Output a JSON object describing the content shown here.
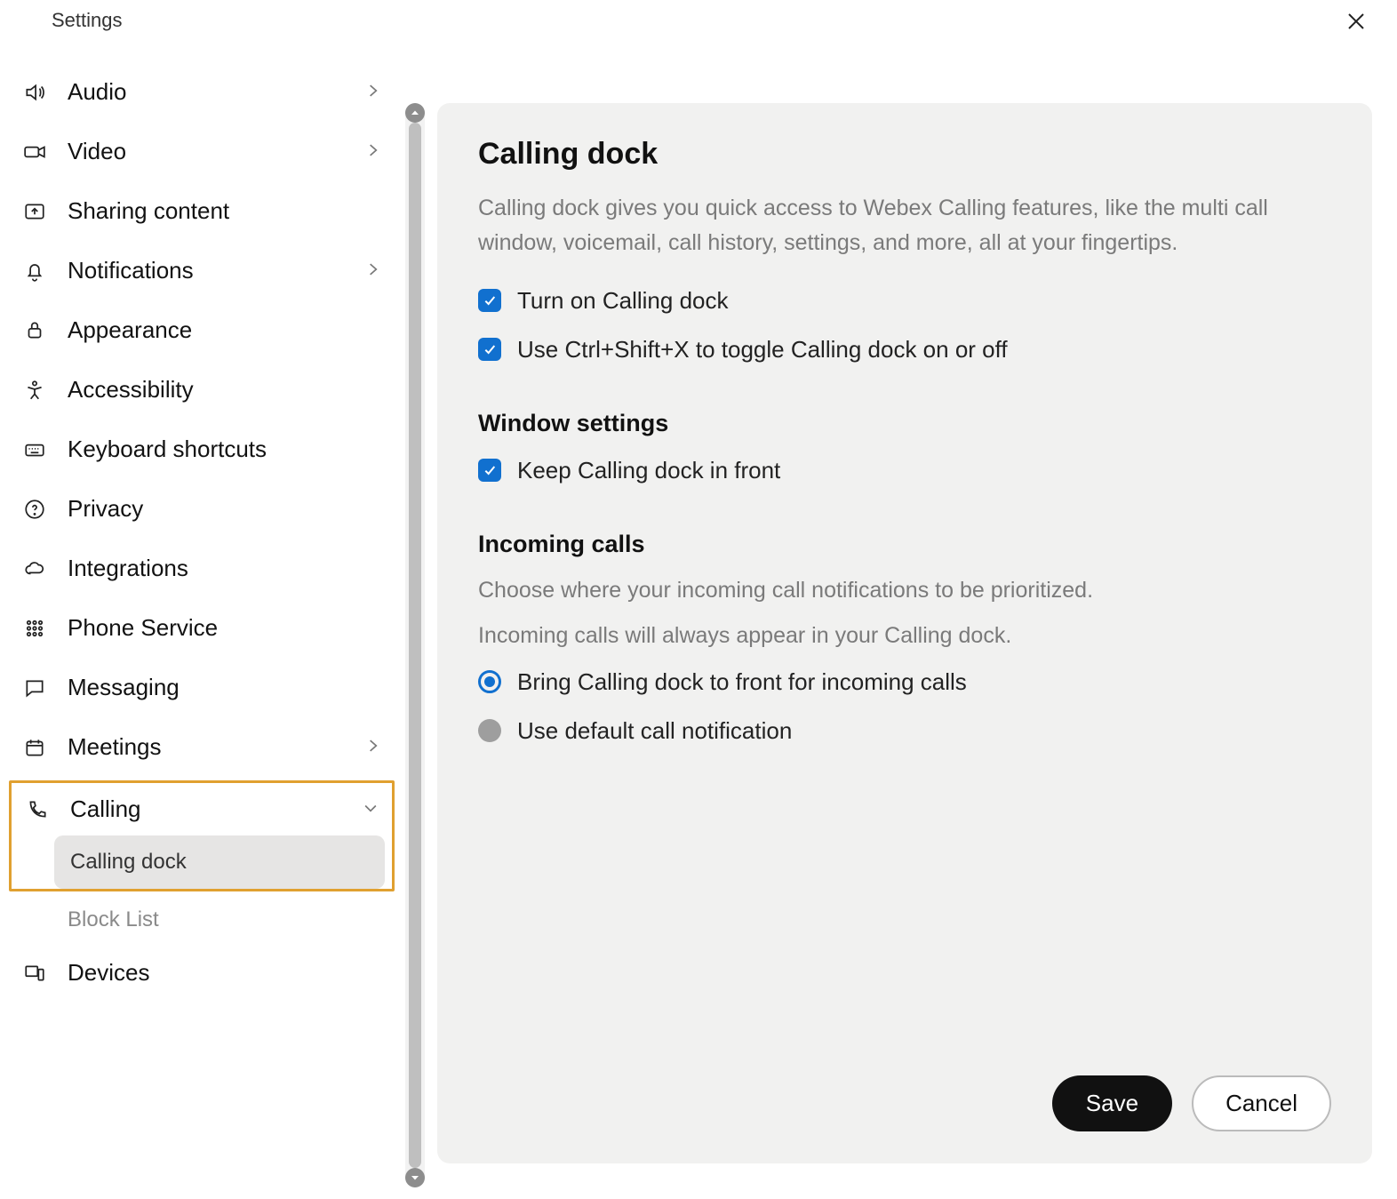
{
  "window": {
    "title": "Settings",
    "close": "close"
  },
  "sidebar": {
    "items": [
      {
        "id": "audio",
        "label": "Audio",
        "expandable": true
      },
      {
        "id": "video",
        "label": "Video",
        "expandable": true
      },
      {
        "id": "sharing",
        "label": "Sharing content",
        "expandable": false
      },
      {
        "id": "notifications",
        "label": "Notifications",
        "expandable": true
      },
      {
        "id": "appearance",
        "label": "Appearance",
        "expandable": false
      },
      {
        "id": "accessibility",
        "label": "Accessibility",
        "expandable": false
      },
      {
        "id": "keyboard",
        "label": "Keyboard shortcuts",
        "expandable": false
      },
      {
        "id": "privacy",
        "label": "Privacy",
        "expandable": false
      },
      {
        "id": "integrations",
        "label": "Integrations",
        "expandable": false
      },
      {
        "id": "phone-service",
        "label": "Phone Service",
        "expandable": false
      },
      {
        "id": "messaging",
        "label": "Messaging",
        "expandable": false
      },
      {
        "id": "meetings",
        "label": "Meetings",
        "expandable": true
      },
      {
        "id": "calling",
        "label": "Calling",
        "expanded": true,
        "children": [
          {
            "id": "calling-dock",
            "label": "Calling dock",
            "selected": true
          },
          {
            "id": "block-list",
            "label": "Block List",
            "selected": false
          }
        ]
      },
      {
        "id": "devices",
        "label": "Devices",
        "expandable": false
      }
    ]
  },
  "panel": {
    "heading": "Calling dock",
    "description": "Calling dock gives you quick access to Webex Calling features, like the multi call window, voicemail, call history, settings, and more, all at your fingertips.",
    "options": {
      "turn_on": {
        "label": "Turn on Calling dock",
        "checked": true
      },
      "toggle_shortcut": {
        "label": "Use Ctrl+Shift+X to toggle Calling dock on or off",
        "checked": true
      }
    },
    "window_settings": {
      "heading": "Window settings",
      "keep_front": {
        "label": "Keep Calling dock in front",
        "checked": true
      }
    },
    "incoming_calls": {
      "heading": "Incoming calls",
      "desc1": "Choose where your incoming call notifications to be prioritized.",
      "desc2": "Incoming calls will always appear in your Calling dock.",
      "choices": [
        {
          "id": "bring-front",
          "label": "Bring Calling dock to front for incoming calls",
          "selected": true
        },
        {
          "id": "default-notification",
          "label": "Use default call notification",
          "selected": false
        }
      ]
    },
    "footer": {
      "save": "Save",
      "cancel": "Cancel"
    }
  }
}
